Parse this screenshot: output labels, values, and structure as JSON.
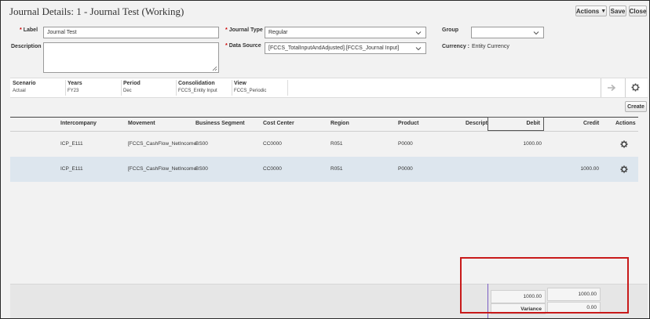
{
  "header": {
    "title": "Journal Details: 1 - Journal Test (Working)",
    "actions_label": "Actions",
    "save_label": "Save",
    "close_label": "Close"
  },
  "form": {
    "label_label": "Label",
    "label_value": "Journal Test",
    "description_label": "Description",
    "description_value": "",
    "journal_type_label": "Journal Type",
    "journal_type_value": "Regular",
    "data_source_label": "Data Source",
    "data_source_value": "[FCCS_TotalInputAndAdjusted].[FCCS_Journal Input]",
    "group_label": "Group",
    "group_value": "",
    "currency_label": "Currency :",
    "currency_value": "Entity Currency",
    "required_mark": "*"
  },
  "pov": [
    {
      "label": "Scenario",
      "value": "Actual"
    },
    {
      "label": "Years",
      "value": "FY23"
    },
    {
      "label": "Period",
      "value": "Dec"
    },
    {
      "label": "Consolidation",
      "value": "FCCS_Entity Input"
    },
    {
      "label": "View",
      "value": "FCCS_Periodic"
    }
  ],
  "create_label": "Create",
  "grid": {
    "columns": [
      "Intercompany",
      "Movement",
      "Business Segment",
      "Cost Center",
      "Region",
      "Product",
      "Descripti",
      "Debit",
      "Credit",
      "Actions"
    ],
    "rows": [
      {
        "intercompany": "ICP_E111",
        "movement": "[FCCS_CashFlow_NetIncome",
        "business_segment": "BS00",
        "cost_center": "CC0000",
        "region": "R051",
        "product": "P0000",
        "description": "",
        "debit": "1000.00",
        "credit": "",
        "selected": false
      },
      {
        "intercompany": "ICP_E111",
        "movement": "[FCCS_CashFlow_NetIncome",
        "business_segment": "BS00",
        "cost_center": "CC0000",
        "region": "R051",
        "product": "P0000",
        "description": "",
        "debit": "",
        "credit": "1000.00",
        "selected": true
      }
    ]
  },
  "totals": {
    "debit_total": "1000.00",
    "credit_total": "1000.00",
    "variance_label": "Variance",
    "variance_value": "0.00"
  },
  "colors": {
    "highlight_box": "#c81a1a",
    "selected_row": "#dde6ee",
    "column_marker": "#7b5cc4"
  }
}
